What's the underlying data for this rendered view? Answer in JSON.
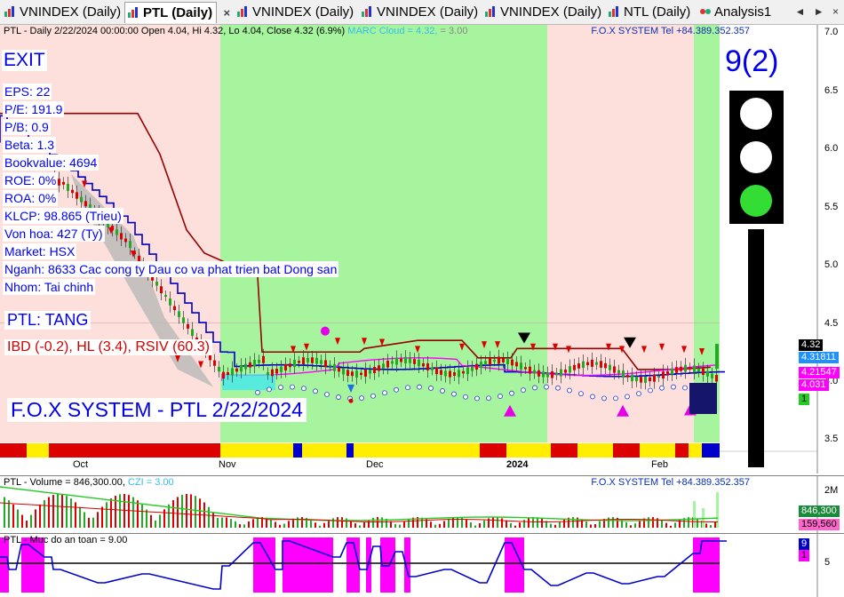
{
  "tabs": [
    {
      "label": "VNINDEX (Daily)",
      "active": false
    },
    {
      "label": "PTL (Daily)",
      "active": true
    },
    {
      "label": "VNINDEX (Daily)",
      "active": false
    },
    {
      "label": "VNINDEX (Daily)",
      "active": false
    },
    {
      "label": "VNINDEX (Daily)",
      "active": false
    },
    {
      "label": "NTL (Daily)",
      "active": false
    },
    {
      "label": "Analysis1",
      "active": false
    }
  ],
  "tab_controls": {
    "prev": "◄",
    "next": "►",
    "close": "×"
  },
  "price_pane": {
    "header_text": "PTL - Daily 2/22/2024 00:00:00 Open 4.04, Hi 4.32, Lo 4.04, Close 4.32 (6.9%)",
    "marc_text": "MARC Cloud = 4.32,",
    "marc_value_2": "= 3.00",
    "header_right": "F.O.X SYSTEM Tel +84.389.352.357",
    "exit_label": "EXIT",
    "score": "9(2)",
    "info": [
      "EPS: 22",
      "P/E: 191.9",
      "P/B: 0.9",
      "Beta: 1.3",
      "Bookvalue: 4694",
      "ROE: 0%",
      "ROA: 0%",
      "KLCP: 98.865 (Trieu)",
      "Von hoa: 427 (Ty)",
      "Market: HSX",
      "Nganh: 8633 Cac cong ty Dau co va phat trien bat Dong san",
      "Nhom: Tai chinh"
    ],
    "trend": "PTL: TANG",
    "indicators": "IBD (-0.2), HL (3.4), RSIV (60.3)",
    "fox_label": "F.O.X SYSTEM - PTL 2/22/2024",
    "y_ticks": [
      "7.0",
      "6.5",
      "6.0",
      "5.5",
      "5.0",
      "4.5",
      "4.0",
      "3.5"
    ],
    "x_labels": [
      "Oct",
      "Nov",
      "Dec",
      "2024",
      "Feb"
    ],
    "price_tags": [
      {
        "text": "4.32",
        "color": "#000000",
        "bg": "#000000",
        "fg": "#ffffff"
      },
      {
        "text": "4.31811",
        "bg": "#1e90ff",
        "fg": "#ffffff"
      },
      {
        "text": "4.21547",
        "bg": "#ff00ff",
        "fg": "#ffffff"
      },
      {
        "text": "4.031",
        "bg": "#ff00ff",
        "fg": "#ffffff"
      },
      {
        "text": "1",
        "bg": "#22cc22",
        "fg": "#000000"
      }
    ],
    "traffic_light": {
      "top": "#ffffff",
      "middle": "#ffffff",
      "bottom": "#33dd33"
    }
  },
  "volume_pane": {
    "header": "PTL - Volume = 846,300.00,",
    "czi": "CZI = 3.00",
    "header_right": "F.O.X SYSTEM Tel +84.389.352.357",
    "y_tick": "2M",
    "tags": [
      {
        "text": "846,300",
        "bg": "#1b8a3a",
        "fg": "#ffffff"
      },
      {
        "text": "159,560",
        "bg": "#ff66cc",
        "fg": "#000000"
      }
    ]
  },
  "safety_pane": {
    "header": "PTL - Muc do an toan = 9.00",
    "y_tick": "5",
    "tags": [
      {
        "text": "9",
        "bg": "#0000cc",
        "fg": "#ffffff"
      },
      {
        "text": "1",
        "bg": "#ff00ff",
        "fg": "#000000"
      }
    ]
  },
  "colors": {
    "bull_zone": "#a6f59e",
    "bear_zone": "#fde0dc",
    "stop_line": "#990000",
    "blue_line": "#0000cc",
    "magenta_line": "#ff00ff",
    "up_candle": "#22aa22",
    "down_candle": "#dd0000"
  }
}
